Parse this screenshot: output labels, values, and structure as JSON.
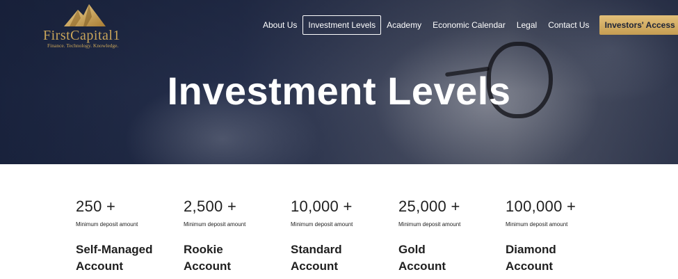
{
  "brand": {
    "name": "FirstCapital1",
    "tagline": "Finance. Technology. Knowledge.",
    "accent": "#c9a55a"
  },
  "nav": {
    "items": [
      {
        "label": "About Us",
        "active": false
      },
      {
        "label": "Investment Levels",
        "active": true
      },
      {
        "label": "Academy",
        "active": false
      },
      {
        "label": "Economic Calendar",
        "active": false
      },
      {
        "label": "Legal",
        "active": false
      },
      {
        "label": "Contact Us",
        "active": false
      }
    ],
    "cta_label": "Investors' Access"
  },
  "hero": {
    "title": "Investment Levels"
  },
  "levels": [
    {
      "amount": "250 +",
      "caption": "Minimum deposit amount",
      "name_line1": "Self-Managed",
      "name_line2": "Account"
    },
    {
      "amount": "2,500 +",
      "caption": "Minimum deposit amount",
      "name_line1": "Rookie",
      "name_line2": "Account"
    },
    {
      "amount": "10,000 +",
      "caption": "Minimum deposit amount",
      "name_line1": "Standard",
      "name_line2": "Account"
    },
    {
      "amount": "25,000 +",
      "caption": "Minimum deposit amount",
      "name_line1": "Gold",
      "name_line2": "Account"
    },
    {
      "amount": "100,000 +",
      "caption": "Minimum deposit amount",
      "name_line1": "Diamond",
      "name_line2": "Account"
    }
  ]
}
